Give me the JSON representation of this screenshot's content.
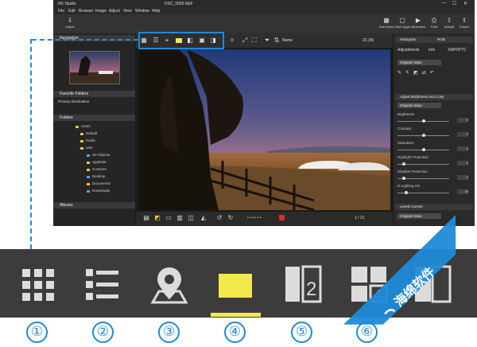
{
  "app": {
    "title": "NX Studio",
    "filename": "DSC_0006.NEF",
    "window_controls": [
      "—",
      "☐",
      "✕"
    ]
  },
  "menu": [
    "File",
    "Edit",
    "Browser",
    "Image",
    "Adjust",
    "View",
    "Window",
    "Help"
  ],
  "toolbar": {
    "import": "Import",
    "right_buttons": [
      "Edit Video",
      "Other Apps",
      "Slideshow",
      "Print",
      "Upload",
      "Export"
    ]
  },
  "left_panel": {
    "navigation": "Navigation",
    "favorite_folders": "Favorite Folders",
    "primary_destination": "Primary Destination",
    "folders": "Folders",
    "tree": [
      "Users",
      "Default",
      "Public",
      "user",
      "3D Objects",
      "AppData",
      "Contacts",
      "Desktop",
      "Documents",
      "Downloads"
    ],
    "albums": "Albums"
  },
  "view_toolbar": {
    "sort": "Name",
    "zoom": "22.3%"
  },
  "bottom_bar": {
    "counter": "1 / 21"
  },
  "right_panel": {
    "histogram": "Histogram",
    "histogram_mode": "RGB",
    "tabs": [
      "Adjustments",
      "Info",
      "XMP/IPTC"
    ],
    "preset": "Original Value",
    "section_brightness": "Adjust Brightness and Color",
    "section_preset": "Original Value",
    "sliders": [
      {
        "label": "Brightness",
        "value": "0",
        "pos": 0.5
      },
      {
        "label": "Contrast",
        "value": "0",
        "pos": 0.5
      },
      {
        "label": "Saturation",
        "value": "0",
        "pos": 0.5
      },
      {
        "label": "Highlight Protection",
        "value": "0",
        "pos": 0.1
      },
      {
        "label": "Shadow Protection",
        "value": "0",
        "pos": 0.1
      },
      {
        "label": "D-Lighting HS",
        "value": "25",
        "pos": 0.15
      }
    ],
    "levels_curves": "Levels Curves",
    "levels_preset": "Original Value"
  },
  "enlarged": {
    "icons": [
      "grid-thumbnails-icon",
      "list-view-icon",
      "map-pin-icon",
      "single-image-icon",
      "compare-two-icon",
      "compare-four-icon"
    ],
    "labels": [
      "2",
      "4"
    ]
  },
  "numbers": [
    "①",
    "②",
    "③",
    "④",
    "⑤",
    "⑥"
  ],
  "watermark": "海绵软件",
  "colors": {
    "accent_blue": "#1f8ad8",
    "yellow": "#f2e94e",
    "strip_bg": "#3c3c3c",
    "app_bg": "#1b1b1b"
  }
}
